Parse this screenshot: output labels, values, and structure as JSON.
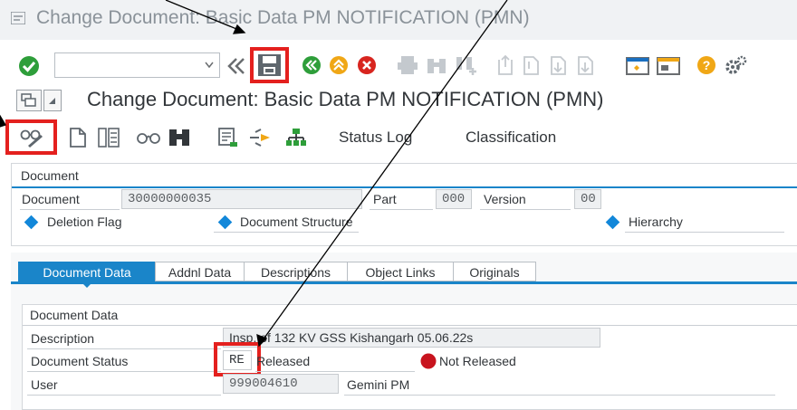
{
  "window": {
    "title": "Change Document: Basic Data PM NOTIFICATION (PMN)"
  },
  "subheader": {
    "title": "Change Document: Basic Data PM NOTIFICATION (PMN)"
  },
  "toolbar": {
    "command_field_value": ""
  },
  "app_toolbar": {
    "status_log": "Status Log",
    "classification": "Classification"
  },
  "document_group": {
    "title": "Document",
    "document_label": "Document",
    "document_value": "30000000035",
    "part_label": "Part",
    "part_value": "000",
    "version_label": "Version",
    "version_value": "00",
    "deletion_flag": "Deletion Flag",
    "document_structure": "Document Structure",
    "hierarchy": "Hierarchy"
  },
  "tabs": [
    {
      "label": "Document Data",
      "active": true
    },
    {
      "label": "Addnl Data",
      "active": false
    },
    {
      "label": "Descriptions",
      "active": false
    },
    {
      "label": "Object Links",
      "active": false
    },
    {
      "label": "Originals",
      "active": false
    }
  ],
  "document_data": {
    "title": "Document Data",
    "description_label": "Description",
    "description_value": "Insp. of 132 KV GSS Kishangarh 05.06.22s",
    "status_label": "Document Status",
    "status_value": "RE",
    "status_text": "Released",
    "not_released": "Not Released",
    "user_label": "User",
    "user_value": "999004610",
    "user_name": "Gemini PM"
  },
  "colors": {
    "accent": "#1a85c9",
    "highlight_red": "#e4201e",
    "status_red": "#c8141e"
  }
}
